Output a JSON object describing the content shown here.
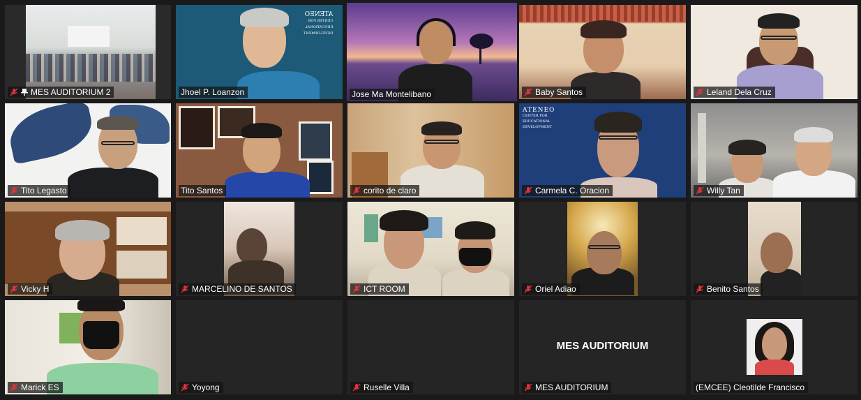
{
  "participants": [
    {
      "name": "MES AUDITORIUM 2",
      "muted": true,
      "pinned": true
    },
    {
      "name": "Jhoel P. Loanzon",
      "muted": false
    },
    {
      "name": "Jose Ma Montelibano",
      "muted": false,
      "active_speaker": true
    },
    {
      "name": "Baby Santos",
      "muted": true
    },
    {
      "name": "Leland Dela Cruz",
      "muted": true
    },
    {
      "name": "Tito Legasto",
      "muted": true
    },
    {
      "name": "Tito Santos",
      "muted": false
    },
    {
      "name": "corito de claro",
      "muted": true
    },
    {
      "name": "Carmela C. Oracion",
      "muted": true
    },
    {
      "name": "Willy Tan",
      "muted": true
    },
    {
      "name": "Vicky H",
      "muted": true
    },
    {
      "name": "MARCELINO DE SANTOS",
      "muted": true
    },
    {
      "name": "ICT ROOM",
      "muted": true
    },
    {
      "name": "Oriel Adiao",
      "muted": true
    },
    {
      "name": "Benito Santos",
      "muted": true
    },
    {
      "name": "Marick ES",
      "muted": true
    },
    {
      "name": "Yoyong",
      "muted": true
    },
    {
      "name": "Ruselle Villa",
      "muted": true
    },
    {
      "name": "MES AUDITORIUM",
      "muted": true,
      "video_off_label": "MES AUDITORIUM"
    },
    {
      "name": "(EMCEE) Cleotilde Francisco",
      "muted": false
    }
  ],
  "backgrounds": {
    "ateneo_mirrored_lines": [
      "ATENEO",
      "CENTER FOR",
      "EDUCATIONAL",
      "DEVELOPMENT"
    ],
    "ateneo_lines": [
      "ATENEO",
      "CENTER FOR",
      "EDUCATIONAL",
      "DEVELOPMENT"
    ]
  },
  "colors": {
    "window_bg": "#1a1a1a",
    "tile_bg": "#252526",
    "active_speaker_border": "#e6e06a",
    "mute_icon": "#e0323c",
    "ateneo_blue": "#1e3f7a",
    "teal_bg": "#1c5a78"
  }
}
